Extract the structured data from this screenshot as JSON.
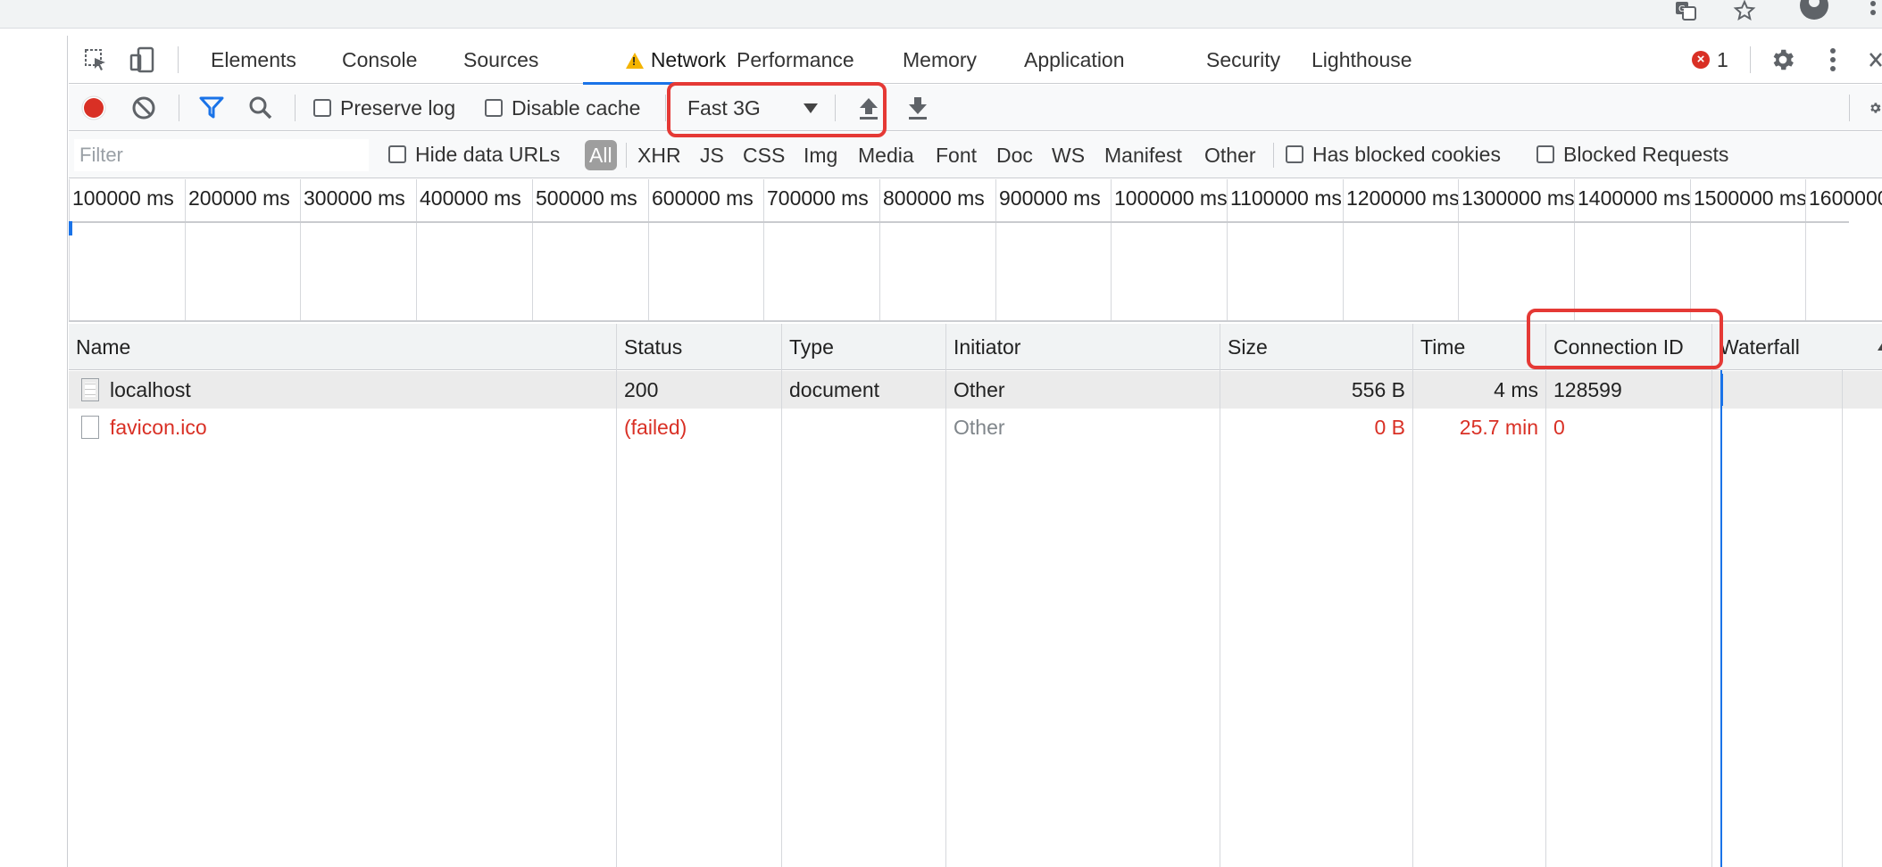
{
  "devtools": {
    "tabs": [
      {
        "label": "Elements"
      },
      {
        "label": "Console"
      },
      {
        "label": "Sources"
      },
      {
        "label": "Network",
        "active": true,
        "warning": true
      },
      {
        "label": "Performance"
      },
      {
        "label": "Memory"
      },
      {
        "label": "Application"
      },
      {
        "label": "Security"
      },
      {
        "label": "Lighthouse"
      }
    ],
    "error_count": "1"
  },
  "toolbar": {
    "preserve_log_label": "Preserve log",
    "preserve_log_checked": false,
    "disable_cache_label": "Disable cache",
    "disable_cache_checked": false,
    "throttle_value": "Fast 3G"
  },
  "filter": {
    "placeholder": "Filter",
    "hide_data_urls_label": "Hide data URLs",
    "types": [
      "All",
      "XHR",
      "JS",
      "CSS",
      "Img",
      "Media",
      "Font",
      "Doc",
      "WS",
      "Manifest",
      "Other"
    ],
    "active_type": "All",
    "has_blocked_cookies_label": "Has blocked cookies",
    "blocked_requests_label": "Blocked Requests"
  },
  "overview": {
    "tick_labels": [
      "100000 ms",
      "200000 ms",
      "300000 ms",
      "400000 ms",
      "500000 ms",
      "600000 ms",
      "700000 ms",
      "800000 ms",
      "900000 ms",
      "1000000 ms",
      "1100000 ms",
      "1200000 ms",
      "1300000 ms",
      "1400000 ms",
      "1500000 ms",
      "1600000"
    ]
  },
  "table": {
    "columns": [
      "Name",
      "Status",
      "Type",
      "Initiator",
      "Size",
      "Time",
      "Connection ID",
      "Waterfall"
    ],
    "rows": [
      {
        "name": "localhost",
        "status": "200",
        "type": "document",
        "initiator": "Other",
        "size": "556 B",
        "time": "4 ms",
        "connection_id": "128599",
        "failed": false
      },
      {
        "name": "favicon.ico",
        "status": "(failed)",
        "type": "",
        "initiator": "Other",
        "size": "0 B",
        "time": "25.7 min",
        "connection_id": "0",
        "failed": true
      }
    ]
  },
  "colors": {
    "accent": "#1a73e8",
    "record": "#d93025",
    "highlight_box": "#e53935",
    "error_text": "#d93025"
  }
}
